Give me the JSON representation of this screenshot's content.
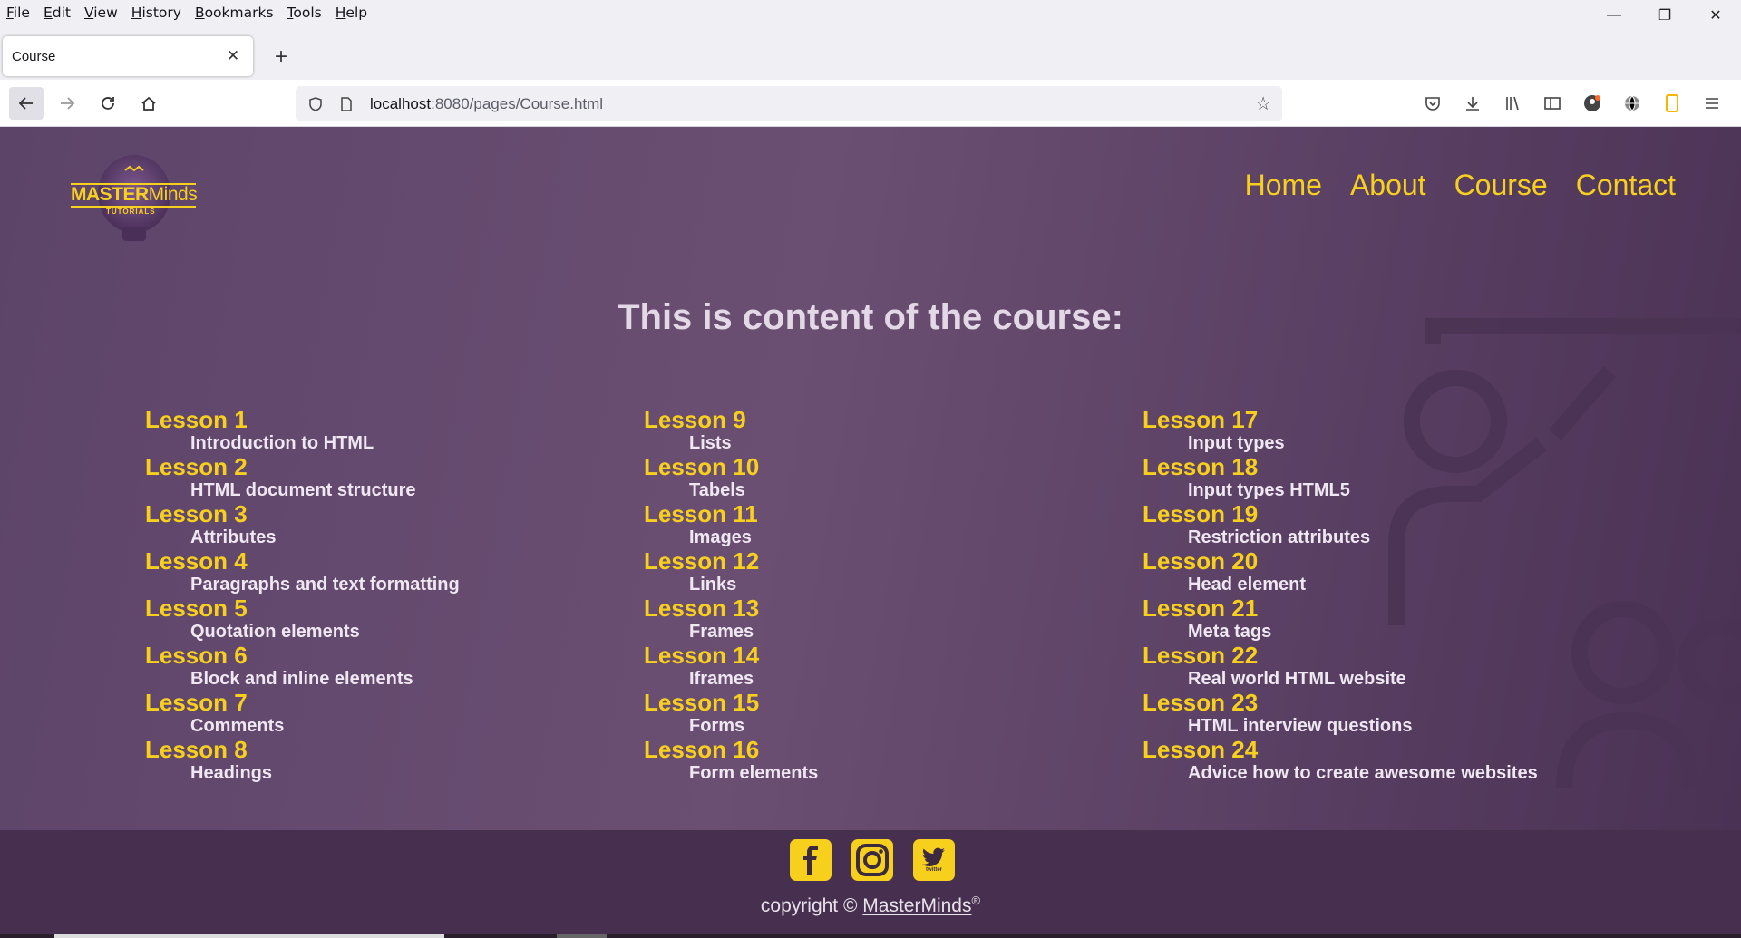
{
  "menubar": {
    "items": [
      "File",
      "Edit",
      "View",
      "History",
      "Bookmarks",
      "Tools",
      "Help"
    ]
  },
  "window_controls": {
    "minimize": "—",
    "restore": "❐",
    "close": "✕"
  },
  "tab": {
    "title": "Course",
    "close": "✕",
    "new_tab": "+"
  },
  "address": {
    "host": "localhost",
    "rest": ":8080/pages/Course.html"
  },
  "site": {
    "logo": {
      "main_a": "MASTER",
      "main_b": "Minds",
      "sub": "TUTORIALS"
    },
    "nav": [
      "Home",
      "About",
      "Course",
      "Contact"
    ],
    "page_title": "This is content of the course:",
    "columns": [
      [
        {
          "name": "Lesson 1",
          "desc": "Introduction to HTML"
        },
        {
          "name": "Lesson 2",
          "desc": "HTML document structure"
        },
        {
          "name": "Lesson 3",
          "desc": "Attributes"
        },
        {
          "name": "Lesson 4",
          "desc": "Paragraphs and text formatting"
        },
        {
          "name": "Lesson 5",
          "desc": "Quotation elements"
        },
        {
          "name": "Lesson 6",
          "desc": "Block and inline elements"
        },
        {
          "name": "Lesson 7",
          "desc": "Comments"
        },
        {
          "name": "Lesson 8",
          "desc": "Headings"
        }
      ],
      [
        {
          "name": "Lesson 9",
          "desc": "Lists"
        },
        {
          "name": "Lesson 10",
          "desc": "Tabels"
        },
        {
          "name": "Lesson 11",
          "desc": "Images"
        },
        {
          "name": "Lesson 12",
          "desc": "Links"
        },
        {
          "name": "Lesson 13",
          "desc": "Frames"
        },
        {
          "name": "Lesson 14",
          "desc": "Iframes"
        },
        {
          "name": "Lesson 15",
          "desc": "Forms"
        },
        {
          "name": "Lesson 16",
          "desc": "Form elements"
        }
      ],
      [
        {
          "name": "Lesson 17",
          "desc": "Input types"
        },
        {
          "name": "Lesson 18",
          "desc": "Input types HTML5"
        },
        {
          "name": "Lesson 19",
          "desc": "Restriction attributes"
        },
        {
          "name": "Lesson 20",
          "desc": "Head element"
        },
        {
          "name": "Lesson 21",
          "desc": "Meta tags"
        },
        {
          "name": "Lesson 22",
          "desc": "Real world HTML website"
        },
        {
          "name": "Lesson 23",
          "desc": "HTML interview questions"
        },
        {
          "name": "Lesson 24",
          "desc": "Advice how to create awesome websites"
        }
      ]
    ],
    "footer": {
      "copyright_prefix": "copyright © ",
      "brand": "MasterMinds",
      "reg": "®",
      "social_icons": [
        "facebook-icon",
        "instagram-icon",
        "twitter-icon"
      ],
      "twitter_label": "twitter"
    }
  },
  "colors": {
    "accent": "#f7d01e",
    "hero": "#5c4468",
    "footer": "#47304f"
  }
}
